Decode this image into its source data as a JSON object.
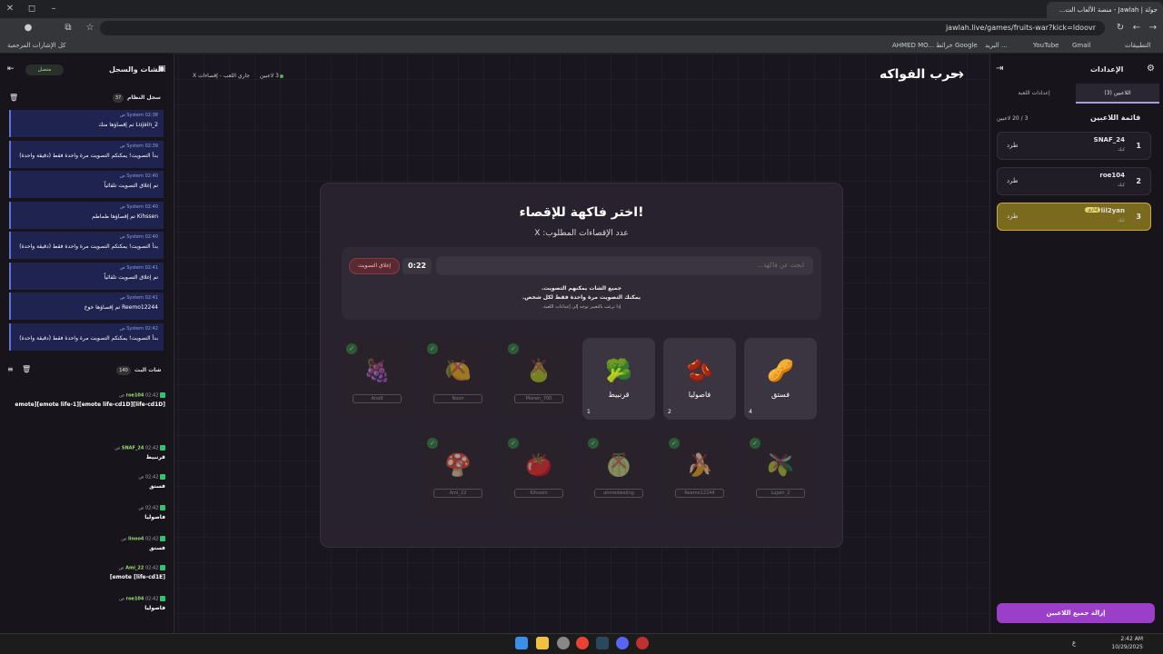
{
  "browser": {
    "tab_title": "جولة | Jawlah - منصة الألعاب الت...",
    "url": "jawlah.live/games/fruits-war?kick=ldoovr",
    "bookmarks": [
      "التطبيقات",
      "Gmail",
      "YouTube",
      "البريد ...",
      "خرائط Google",
      "AHMED MO..."
    ],
    "all_bookmarks": "كل الإشارات المرجعية"
  },
  "left": {
    "title": "الشات والسجل",
    "status": "متصل",
    "log_title": "سجل النظام",
    "log_count": "37",
    "log": [
      {
        "time": "02:38 ص",
        "text": "Lujain_2 تم إقصاؤها منك"
      },
      {
        "time": "02:39 ص",
        "text": "بدأ التصويت! يمكنكم التصويت مرة واحدة فقط (دقيقة واحدة)"
      },
      {
        "time": "02:40 ص",
        "text": "تم إغلاق التصويت تلقائياً"
      },
      {
        "time": "02:40 ص",
        "text": "Kihssen تم إقصاؤها طماطم"
      },
      {
        "time": "02:40 ص",
        "text": "بدأ التصويت! يمكنكم التصويت مرة واحدة فقط (دقيقة واحدة)"
      },
      {
        "time": "02:41 ص",
        "text": "تم إغلاق التصويت تلقائياً"
      },
      {
        "time": "02:41 ص",
        "text": "Reemo12244 تم إقصاؤها خوخ"
      },
      {
        "time": "02:42 ص",
        "text": "بدأ التصويت! يمكنكم التصويت مرة واحدة فقط (دقيقة واحدة)"
      }
    ],
    "log_sender": "System",
    "chat_title": "شات البث",
    "chat_count": "140",
    "chat": [
      {
        "name": "roe104",
        "time": "02:42 ص",
        "text": "[life-cd1D][emote life-cd1D][emote life-1][emote"
      },
      {
        "name": "SNAF_24",
        "time": "02:42 ص",
        "text": "قرنبيط"
      },
      {
        "name": "",
        "time": "02:42 ص",
        "text": "فستق"
      },
      {
        "name": "",
        "time": "02:42 ص",
        "text": "فاصوليا"
      },
      {
        "name": "linoo4",
        "time": "02:42 ص",
        "text": "فستق"
      },
      {
        "name": "Ami_22",
        "time": "02:42 ص",
        "text": "[life-cd1E] emote]"
      },
      {
        "name": "roe104",
        "time": "02:42 ص",
        "text": "فاصوليا"
      }
    ]
  },
  "main": {
    "game_title": "حرب الفواكه",
    "status": "جاري اللعب - إقصاءات X",
    "players_online": "3 لاعبين",
    "card_title": "اختر فاكهة للإقصاء!",
    "card_sub": "عدد الإقصاءات المطلوب: X",
    "search_placeholder": "ابحث عن فاكهة...",
    "timer": "0:22",
    "close_vote": "إغلاق التصويت",
    "note1": "جميع الشات يمكنهم التصويت.",
    "note2": "يمكنك التصويت مرة واحدة فقط لكل شخص.",
    "note3": "إذا ترغب بالتغيير توجه إلى إعدادات اللعبة.",
    "fruits_row1": [
      {
        "name": "فستق",
        "emoji": "🥜",
        "votes": "4",
        "dead": false
      },
      {
        "name": "فاصوليا",
        "emoji": "🫘",
        "votes": "2",
        "dead": false
      },
      {
        "name": "قرنبيط",
        "emoji": "🥦",
        "votes": "1",
        "dead": false
      },
      {
        "name": "Marwn_700",
        "emoji": "🍐",
        "dead": true
      },
      {
        "name": "Noon",
        "emoji": "🍋",
        "dead": true
      },
      {
        "name": "Ana9",
        "emoji": "🍇",
        "dead": true
      }
    ],
    "fruits_row2": [
      {
        "name": "Lujain_2",
        "emoji": "🫒",
        "dead": true
      },
      {
        "name": "Reemo12244",
        "emoji": "🍌",
        "dead": true
      },
      {
        "name": "ahmedwaling",
        "emoji": "🍈",
        "dead": true
      },
      {
        "name": "Kihssen",
        "emoji": "🍅",
        "dead": true
      },
      {
        "name": "Ami_22",
        "emoji": "🍄",
        "dead": true
      }
    ]
  },
  "right": {
    "title": "الإعدادات",
    "tab_players": "اللاعبين (3)",
    "tab_settings": "إعدادات اللعبة",
    "list_title": "قائمة اللاعبين",
    "count": "3 / 20 لاعبين",
    "players": [
      {
        "num": "1",
        "name": "SNAF_24",
        "role": "كيك",
        "kick": "طرد"
      },
      {
        "num": "2",
        "name": "roe104",
        "role": "كيك",
        "kick": "طرد"
      },
      {
        "num": "3",
        "name": "lil2yan",
        "role": "كيك",
        "kick": "طرد",
        "badge": "إداري"
      }
    ],
    "remove_all": "إزالة جميع اللاعبين"
  },
  "taskbar": {
    "time": "2:42 AM",
    "date": "10/29/2025",
    "lang": "ع"
  }
}
